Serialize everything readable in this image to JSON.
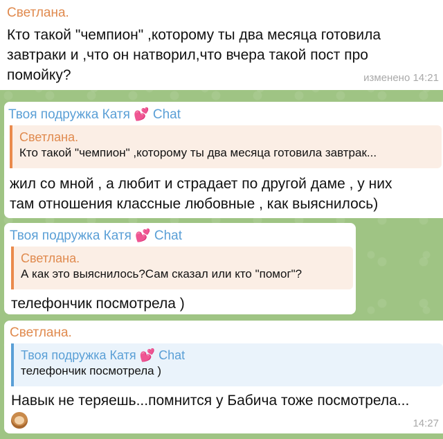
{
  "messages": [
    {
      "sender": "Светлана.",
      "lines": [
        "Кто такой \"чемпион\" ,которому ты два месяца готовила",
        "завтраки и ,что он натворил,что вчера такой пост про",
        "помойку?"
      ],
      "edited_time": "изменено 14:21"
    },
    {
      "sender": "Твоя подружка Катя",
      "sender_suffix": "Chat",
      "heart_icon": "💕",
      "reply": {
        "name": "Светлана.",
        "text": "Кто такой \"чемпион\" ,которому ты два месяца готовила завтрак..."
      },
      "lines": [
        "жил со мной , а любит и страдает по другой даме , у них",
        "там отношения классные любовные , как выяснилось)"
      ]
    },
    {
      "sender": "Твоя подружка Катя",
      "sender_suffix": "Chat",
      "heart_icon": "💕",
      "reply": {
        "name": "Светлана.",
        "text": "А как это выяснилось?Сам сказал или кто \"помог\"?"
      },
      "lines": [
        "телефончик посмотрела )"
      ]
    },
    {
      "sender": "Светлана.",
      "reply": {
        "name": "Твоя подружка Катя",
        "suffix": "Chat",
        "heart_icon": "💕",
        "text": "телефончик посмотрела )"
      },
      "lines": [
        "Навык  не теряешь...помнится у Бабича тоже посмотрела..."
      ],
      "emoji": "monkey-face-icon",
      "time": "14:27"
    }
  ]
}
